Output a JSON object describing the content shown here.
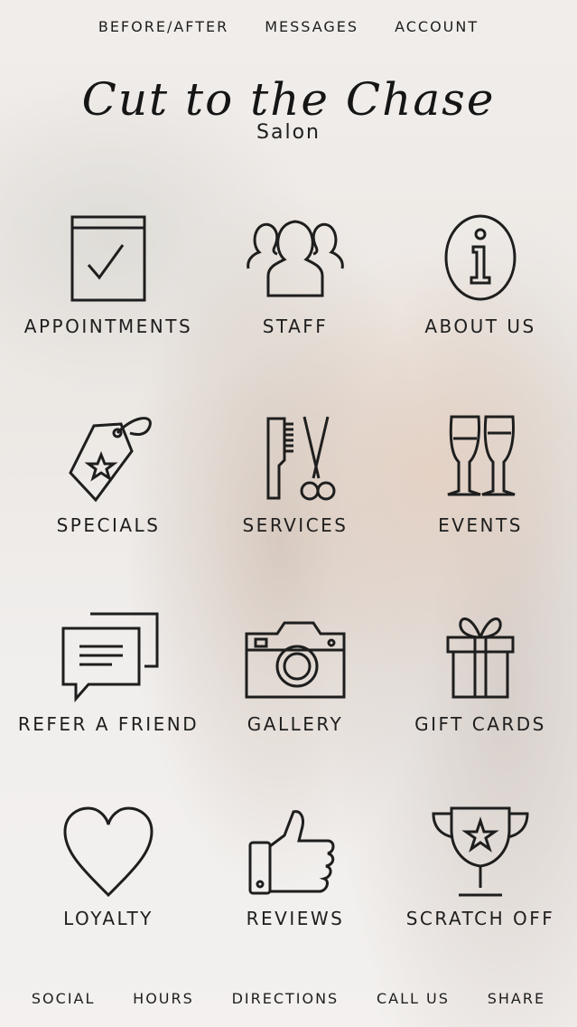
{
  "top_nav": {
    "before_after": "BEFORE/AFTER",
    "messages": "MESSAGES",
    "account": "ACCOUNT"
  },
  "logo": {
    "script": "Cut to the Chase",
    "sub": "Salon"
  },
  "tiles": [
    {
      "label": "APPOINTMENTS",
      "icon": "calendar-check-icon"
    },
    {
      "label": "STAFF",
      "icon": "people-icon"
    },
    {
      "label": "ABOUT US",
      "icon": "info-icon"
    },
    {
      "label": "SPECIALS",
      "icon": "price-tag-star-icon"
    },
    {
      "label": "SERVICES",
      "icon": "comb-scissors-icon"
    },
    {
      "label": "EVENTS",
      "icon": "wine-glasses-icon"
    },
    {
      "label": "REFER A FRIEND",
      "icon": "chat-bubbles-icon"
    },
    {
      "label": "GALLERY",
      "icon": "camera-icon"
    },
    {
      "label": "GIFT CARDS",
      "icon": "gift-icon"
    },
    {
      "label": "LOYALTY",
      "icon": "heart-icon"
    },
    {
      "label": "REVIEWS",
      "icon": "thumbs-up-icon"
    },
    {
      "label": "SCRATCH OFF",
      "icon": "trophy-icon"
    }
  ],
  "bottom_nav": {
    "social": "SOCIAL",
    "hours": "HOURS",
    "directions": "DIRECTIONS",
    "call_us": "CALL US",
    "share": "SHARE"
  },
  "colors": {
    "icon_stroke": "#1e1e1e",
    "text": "#1e1e1e"
  }
}
